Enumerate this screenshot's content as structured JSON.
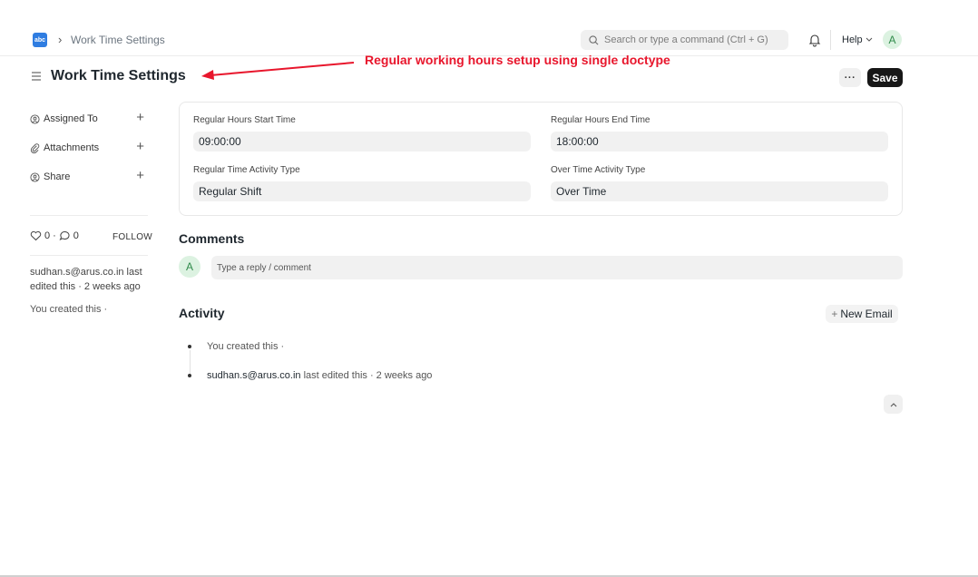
{
  "navbar": {
    "logo_text": "abc",
    "breadcrumb": "Work Time Settings",
    "search_placeholder": "Search or type a command (Ctrl + G)",
    "help_label": "Help",
    "avatar_letter": "A"
  },
  "page": {
    "title": "Work Time Settings",
    "annotation": "Regular working hours setup using single doctype",
    "annotation_color": "#e8162c",
    "more_label": "···",
    "save_label": "Save"
  },
  "sidebar": {
    "items": [
      {
        "label": "Assigned To"
      },
      {
        "label": "Attachments"
      },
      {
        "label": "Share"
      }
    ],
    "likes": "0",
    "comments": "0",
    "follow_label": "FOLLOW",
    "edited_by": "sudhan.s@arus.co.in last edited this · 2 weeks ago",
    "created": "You created this ·"
  },
  "form": {
    "start_label": "Regular Hours Start Time",
    "start_value": "09:00:00",
    "end_label": "Regular Hours End Time",
    "end_value": "18:00:00",
    "regular_activity_label": "Regular Time Activity Type",
    "regular_activity_value": "Regular Shift",
    "overtime_activity_label": "Over Time Activity Type",
    "overtime_activity_value": "Over Time"
  },
  "comments": {
    "title": "Comments",
    "avatar_letter": "A",
    "placeholder": "Type a reply / comment"
  },
  "activity": {
    "title": "Activity",
    "new_email_label": "New Email",
    "items": [
      {
        "user": "",
        "text": "You created this ·"
      },
      {
        "user": "sudhan.s@arus.co.in",
        "text": " last edited this · 2 weeks ago"
      }
    ]
  },
  "colors": {
    "save_bg": "#171717",
    "avatar_bg": "#dcf2e1",
    "accent_logo": "#2f7de1"
  }
}
